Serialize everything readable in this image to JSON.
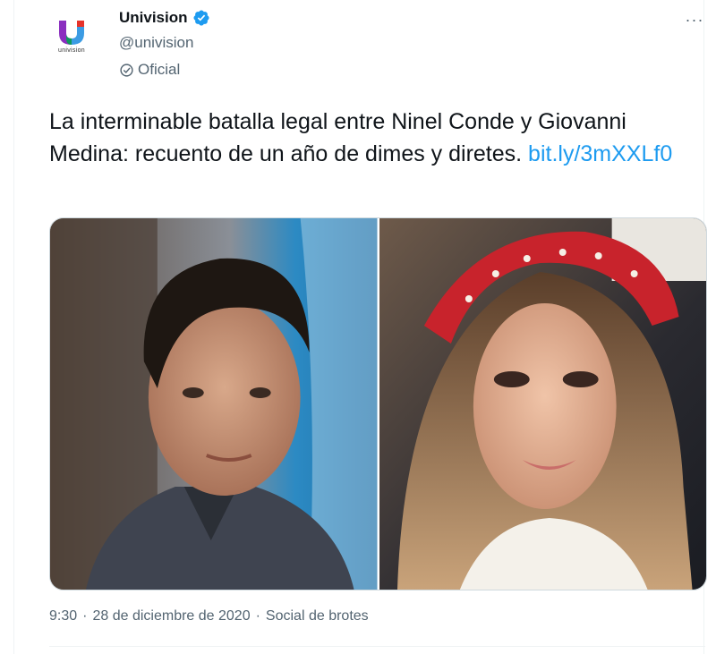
{
  "author": {
    "display_name": "Univision",
    "handle": "@univision",
    "affiliation": "Oficial",
    "avatar_text": "univision",
    "verified_icon": "verified-badge-icon",
    "brand_colors": [
      "#8b2fbf",
      "#e6332a",
      "#3b9be3",
      "#00a651"
    ]
  },
  "menu": {
    "more_label": "···"
  },
  "tweet": {
    "text": "La interminable batalla legal entre Ninel Conde y Giovanni Medina: recuento de un año de dimes y diretes. ",
    "link": "bit.ly/3mXXLf0"
  },
  "media": {
    "photo_count": 2
  },
  "meta": {
    "time": "9:30",
    "separator_1": "·",
    "date": "28 de diciembre de 2020",
    "separator_2": "·",
    "source": "Social de brotes"
  },
  "colors": {
    "link": "#1d9bf0",
    "verified": "#1d9bf0",
    "secondary_text": "#536471"
  }
}
